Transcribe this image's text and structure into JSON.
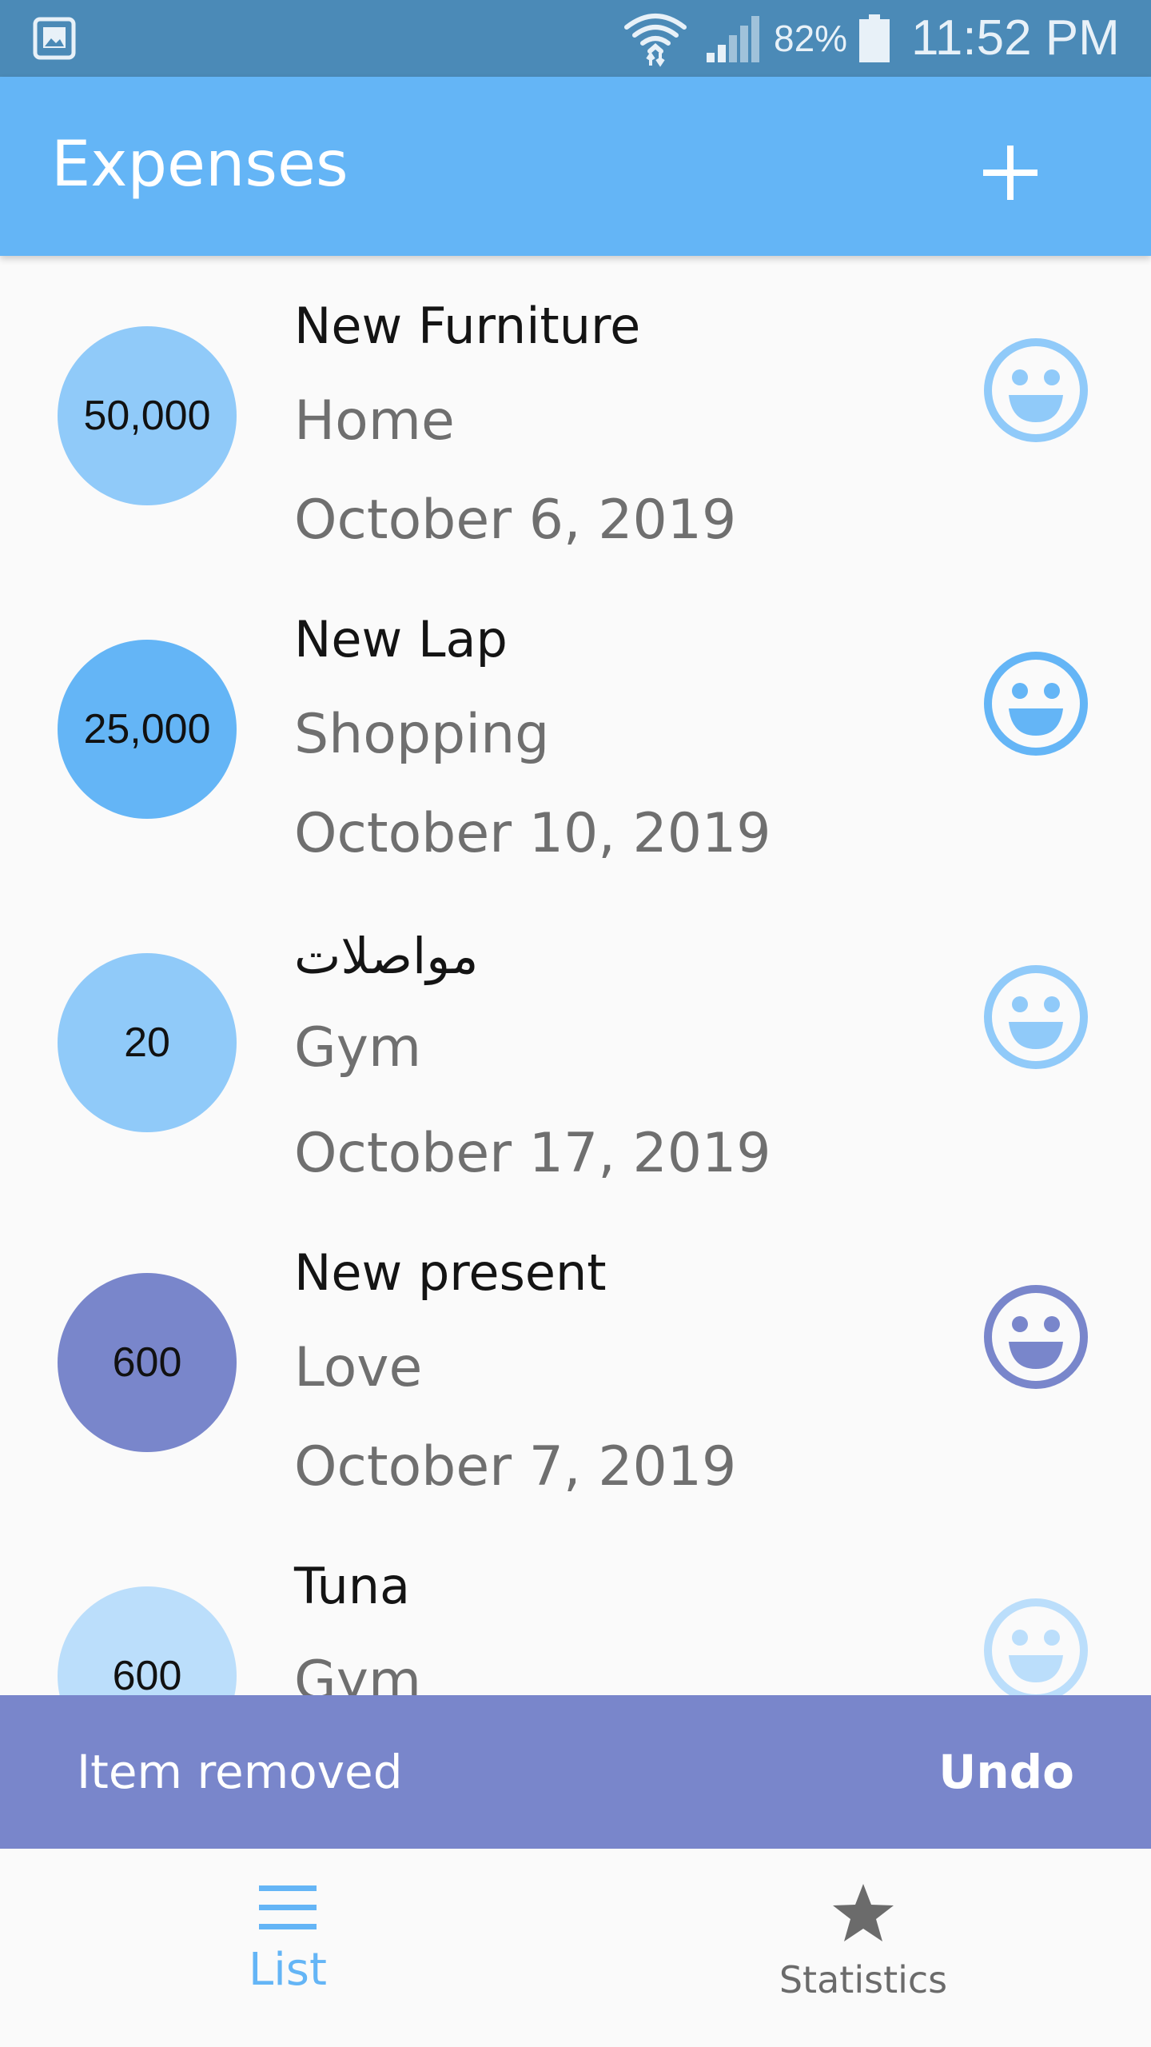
{
  "status_bar": {
    "battery_percent": "82%",
    "time": "11:52 PM",
    "icons": [
      "gallery-icon",
      "wifi-icon",
      "signal-icon",
      "battery-icon"
    ]
  },
  "app_bar": {
    "title": "Expenses",
    "add_icon": "plus-icon"
  },
  "expenses": [
    {
      "amount": "50,000",
      "title": "New Furniture",
      "category": "Home",
      "date": "October 6, 2019",
      "color": "#90caf9",
      "text_color": "#111111"
    },
    {
      "amount": "25,000",
      "title": "New Lap",
      "category": "Shopping",
      "date": "October 10, 2019",
      "color": "#64b5f6",
      "text_color": "#111111"
    },
    {
      "amount": "20",
      "title": "مواصلات",
      "category": "Gym",
      "date": "October 17, 2019",
      "color": "#90caf9",
      "text_color": "#111111"
    },
    {
      "amount": "600",
      "title": "New present",
      "category": "Love",
      "date": "October 7, 2019",
      "color": "#7986cb",
      "text_color": "#111111"
    },
    {
      "amount": "600",
      "title": "Tuna",
      "category": "Gym",
      "date": "",
      "color": "#bbdefb",
      "text_color": "#111111"
    }
  ],
  "snackbar": {
    "message": "Item removed",
    "action": "Undo",
    "color": "#7986cb"
  },
  "bottom_nav": {
    "items": [
      {
        "label": "List",
        "icon": "list-icon",
        "active": true
      },
      {
        "label": "Statistics",
        "icon": "star-icon",
        "active": false
      }
    ],
    "active_color": "#64b5f6",
    "inactive_color": "#6b6b6b"
  }
}
